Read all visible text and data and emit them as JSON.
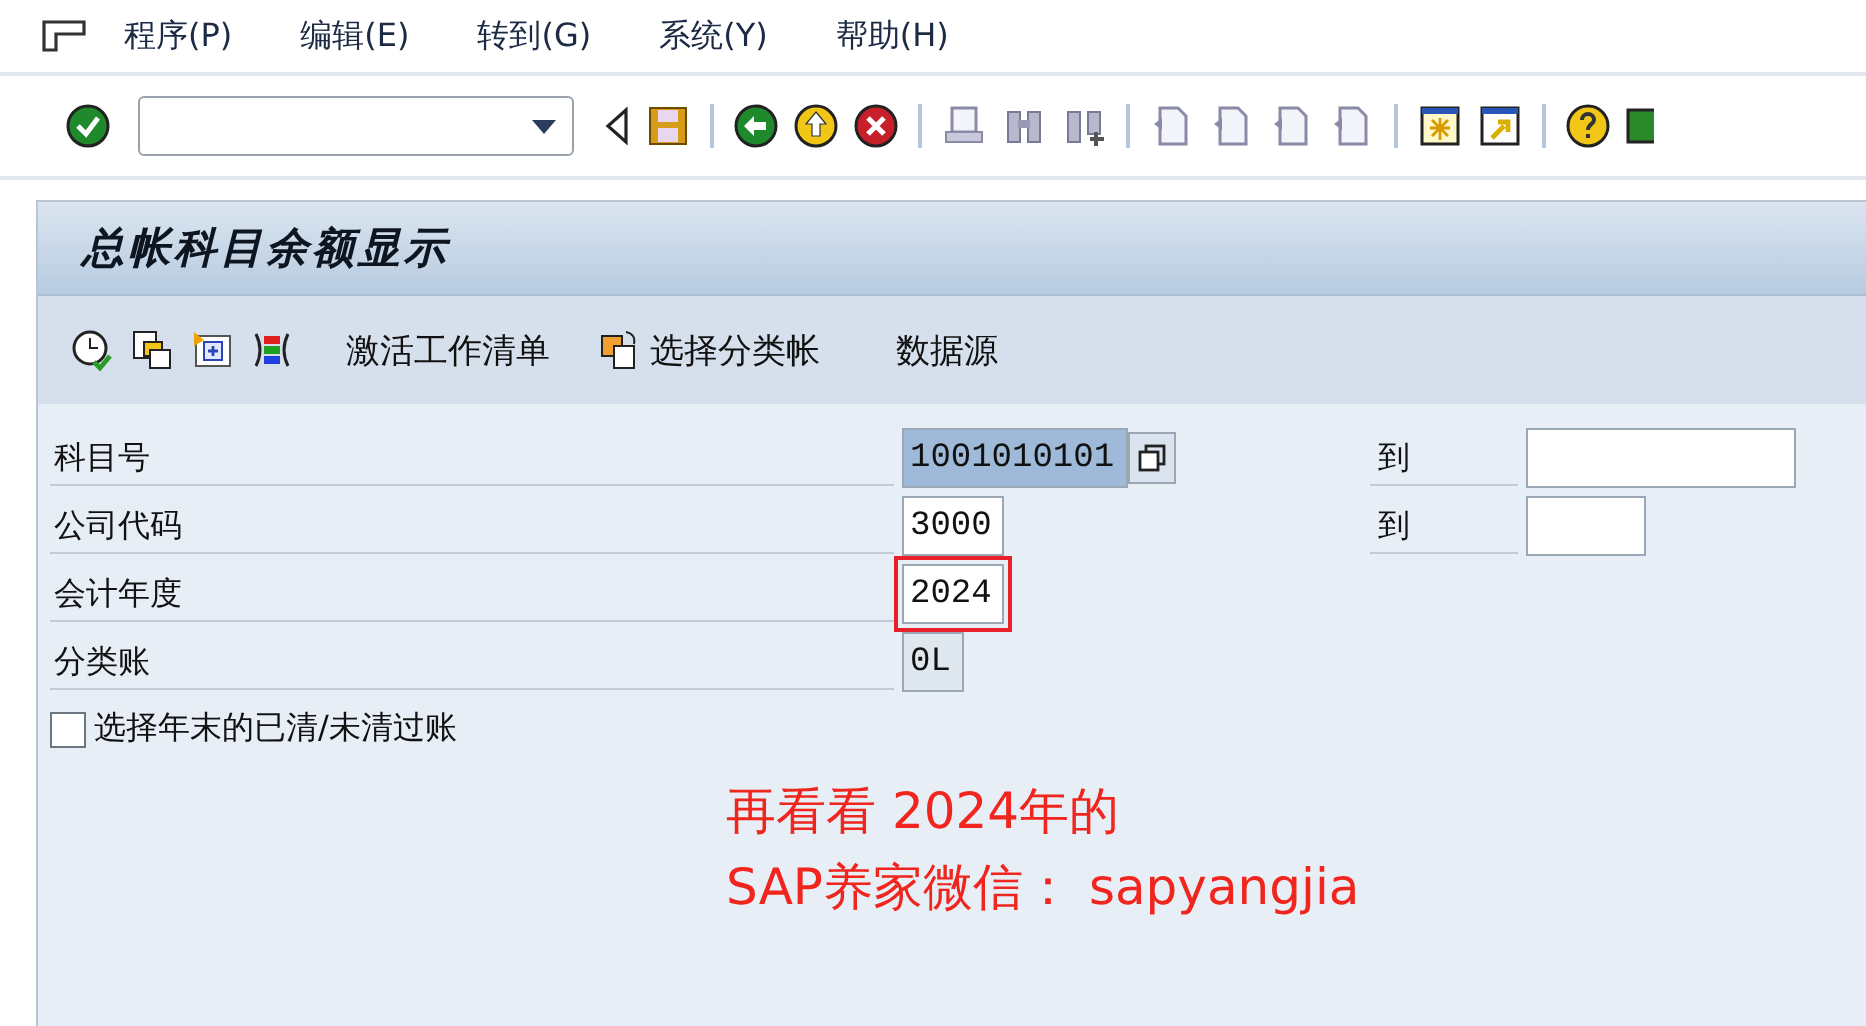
{
  "menu": [
    {
      "label": "程序(P)"
    },
    {
      "label": "编辑(E)"
    },
    {
      "label": "转到(G)"
    },
    {
      "label": "系统(Y)"
    },
    {
      "label": "帮助(H)"
    }
  ],
  "screen_title": "总帐科目余额显示",
  "app_toolbar": [
    {
      "kind": "text",
      "label": "激活工作清单"
    },
    {
      "kind": "icon_text",
      "label": "选择分类帐"
    },
    {
      "kind": "text",
      "label": "数据源"
    }
  ],
  "fields": [
    {
      "label": "科目号",
      "value": "1001010101",
      "focused": true,
      "highlighted": false,
      "multi_select": true,
      "range_label": "到"
    },
    {
      "label": "公司代码",
      "value": "3000",
      "focused": false,
      "highlighted": false,
      "multi_select": false,
      "range_label": "到"
    },
    {
      "label": "会计年度",
      "value": "2024",
      "focused": false,
      "highlighted": true,
      "multi_select": false
    },
    {
      "label": "分类账",
      "value": "0L",
      "focused": false,
      "highlighted": false,
      "multi_select": false,
      "readonly": true
    }
  ],
  "checkbox": {
    "label": "选择年末的已清/未清过账",
    "checked": false
  },
  "annotation": [
    "再看看 2024年的",
    "SAP养家微信： sapyangjia"
  ]
}
